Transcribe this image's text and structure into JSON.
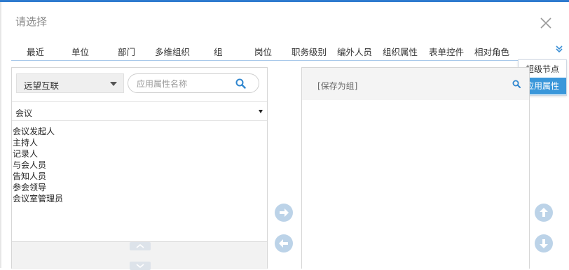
{
  "dialog": {
    "title": "请选择"
  },
  "tabs": [
    "最近",
    "单位",
    "部门",
    "多维组织",
    "组",
    "岗位",
    "职务级别",
    "编外人员",
    "组织属性",
    "表单控件",
    "相对角色"
  ],
  "dropdown": {
    "items": [
      "超级节点",
      "应用属性"
    ],
    "active_index": 1
  },
  "left_panel": {
    "org_select": "远望互联",
    "search_placeholder": "应用属性名称",
    "category": "会议",
    "items": [
      "会议发起人",
      "主持人",
      "记录人",
      "与会人员",
      "告知人员",
      "参会领导",
      "会议室管理员"
    ]
  },
  "right_panel": {
    "save_as_group": "[保存为组]"
  },
  "colors": {
    "accent": "#3a97da",
    "tab_underline": "#a9c9ea",
    "arrow_button": "#bcd3e8",
    "top_bar": "#2e7bcf"
  }
}
